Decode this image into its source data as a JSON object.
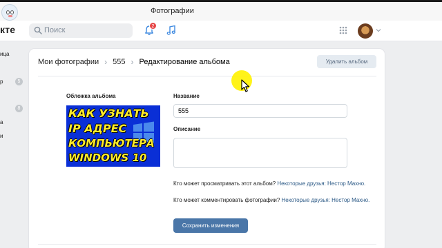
{
  "window": {
    "title": "Фотографии"
  },
  "header": {
    "brand": "кте",
    "search_placeholder": "Поиск",
    "notifications_count": "2"
  },
  "sidebar": {
    "items": [
      {
        "label": "ица"
      },
      {
        "label": "р",
        "count": "5"
      },
      {
        "label": "",
        "count": "8"
      },
      {
        "label": "а"
      },
      {
        "label": "и"
      }
    ]
  },
  "breadcrumb": {
    "root": "Мои фотографии",
    "album": "555",
    "current": "Редактирование альбома"
  },
  "delete_album_label": "Удалить альбом",
  "cover": {
    "label": "Обложка альбома",
    "image_text": [
      "КАК УЗНАТЬ",
      "IP АДРЕС",
      "КОМПЬЮТЕРА",
      "WINDOWS 10"
    ]
  },
  "form": {
    "name_label": "Название",
    "name_value": "555",
    "description_label": "Описание",
    "description_value": "",
    "view_question": "Кто может просматривать этот альбом?",
    "view_value": "Некоторые друзья: Нестор Махно.",
    "comment_question": "Кто может комментировать фотографии?",
    "comment_value": "Некоторые друзья: Нестор Махно.",
    "save_label": "Сохранить изменения"
  },
  "colors": {
    "accent": "#4a76a8",
    "link": "#2a5885",
    "badge": "#e64646",
    "cursor_highlight": "#fff200"
  }
}
